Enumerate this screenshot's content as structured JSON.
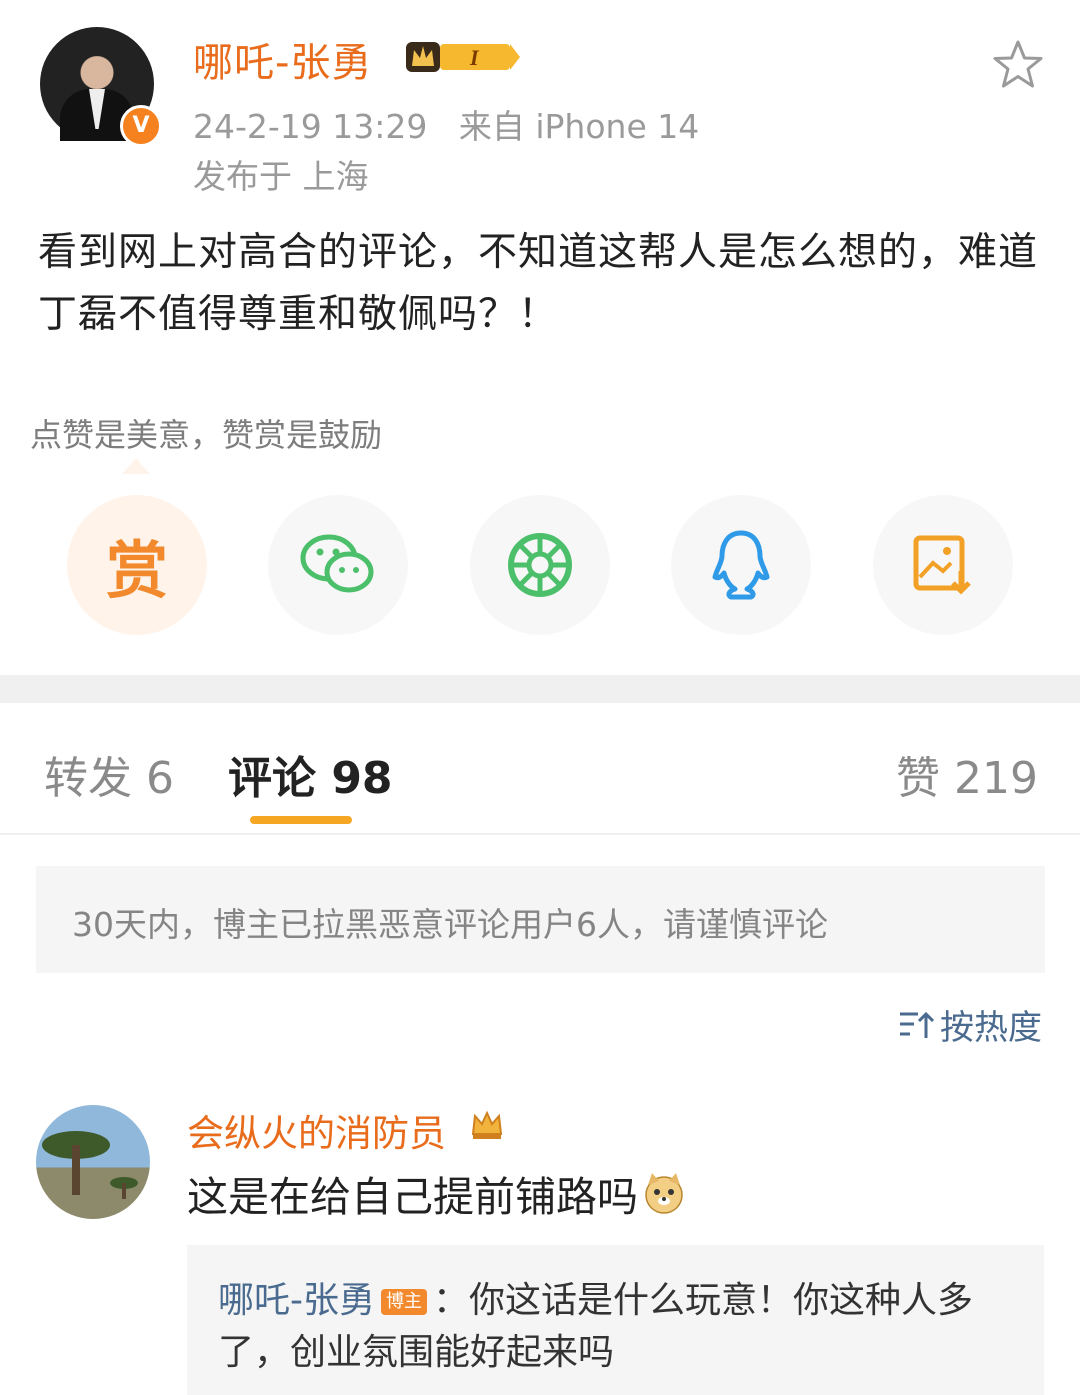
{
  "post": {
    "author": "哪吒-张勇",
    "level_badge": "I",
    "timestamp": "24-2-19 13:29",
    "source": "来自 iPhone 14",
    "location": "发布于 上海",
    "content": "看到网上对高合的评论，不知道这帮人是怎么想的，难道丁磊不值得尊重和敬佩吗？！",
    "verified_badge": "V"
  },
  "share": {
    "tip": "点赞是美意，赞赏是鼓励",
    "reward_label": "赏",
    "icons": [
      "reward-icon",
      "wechat-icon",
      "moments-icon",
      "qq-icon",
      "save-image-icon"
    ]
  },
  "tabs": {
    "repost": "转发 6",
    "comments": "评论 98",
    "likes": "赞 219"
  },
  "notice": "30天内，博主已拉黑恶意评论用户6人，请谨慎评论",
  "sort": {
    "label": "按热度",
    "icon": "sort-icon"
  },
  "comments": [
    {
      "author": "会纵火的消防员",
      "text": "这是在给自己提前铺路吗",
      "reply": {
        "author": "哪吒-张勇",
        "badge": "博主",
        "text": "：你这话是什么玩意！你这种人多了，创业氛围能好起来吗"
      }
    }
  ],
  "colors": {
    "accent": "#e86c1c",
    "link": "#4a6b8f",
    "tab_underline": "#f5a623"
  }
}
